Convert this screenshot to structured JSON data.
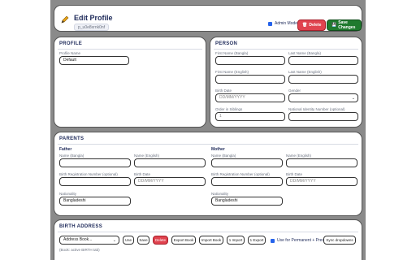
{
  "header": {
    "title": "Edit Profile",
    "profile_id": "p_u0e8xrnk0nf",
    "admin_label": "Admin Mode",
    "delete_label": "Delete",
    "save_label": "Save Changes"
  },
  "profile": {
    "section_title": "PROFILE",
    "name_label": "Profile Name",
    "name_value": "Default"
  },
  "person": {
    "section_title": "PERSON",
    "first_bn_label": "First Name (Bangla)",
    "last_bn_label": "Last Name (Bangla)",
    "first_en_label": "First Name (English)",
    "last_en_label": "Last Name (English)",
    "birth_label": "Birth Date",
    "birth_placeholder": "DD/MM/YYYY",
    "gender_label": "Gender",
    "order_label": "Order in Siblings",
    "order_placeholder": "1",
    "nid_label": "National Identity Number (optional)"
  },
  "parents": {
    "section_title": "PARENTS",
    "father": {
      "heading": "Father",
      "name_bn_label": "Name (Bangla)",
      "name_en_label": "Name (English)",
      "brn_label": "Birth Registration Number (optional)",
      "birth_label": "Birth Date",
      "birth_placeholder": "DD/MM/YYYY",
      "nationality_label": "Nationality",
      "nationality_value": "Bangladeshi"
    },
    "mother": {
      "heading": "Mother",
      "name_bn_label": "Name (Bangla)",
      "name_en_label": "Name (English)",
      "brn_label": "Birth Registration Number (optional)",
      "birth_label": "Birth Date",
      "birth_placeholder": "DD/MM/YYYY",
      "nationality_label": "Nationality",
      "nationality_value": "Bangladeshi"
    }
  },
  "birth_address": {
    "section_title": "BIRTH ADDRESS",
    "address_book_value": "Address Book...",
    "use_label": "Use",
    "save_label": "Save",
    "delete_label": "Delete",
    "export_book_label": "Export Book",
    "import_book_label": "Import Book",
    "import1_label": "1 Import",
    "export1_label": "1 Export",
    "use_for_label": "Use for Permanent + Present",
    "sync_label": "Sync dropdowns",
    "hint": "(Book: active BIRTH tab)"
  },
  "colors": {
    "accent": "#1e2a5a",
    "danger": "#e0434f",
    "success": "#1f7a2e",
    "backdrop": "#8a8a8a"
  }
}
